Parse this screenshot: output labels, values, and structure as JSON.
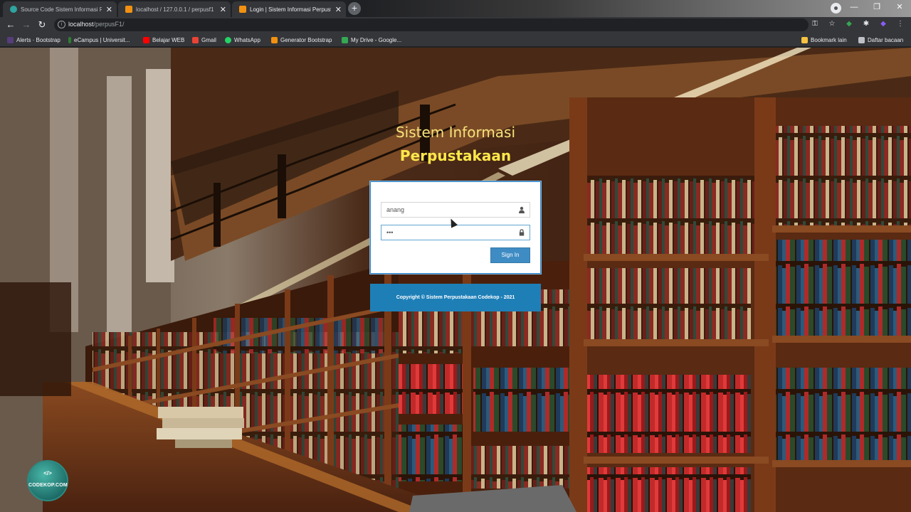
{
  "browser": {
    "tabs": [
      {
        "title": "Source Code Sistem Informasi Pe",
        "favicon_color": "#2fa4a0",
        "active": false
      },
      {
        "title": "localhost / 127.0.0.1 / perpusf1 |",
        "favicon_color": "#f29111",
        "active": false
      },
      {
        "title": "Login | Sistem Informasi Perpust",
        "favicon_color": "#f29111",
        "active": true
      }
    ],
    "new_tab": "+",
    "window_buttons": [
      "—",
      "❐",
      "✕"
    ],
    "url_host": "localhost",
    "url_path": "/perpusF1/",
    "bookmarks": [
      {
        "label": "Alerts · Bootstrap",
        "color": "#563d7c"
      },
      {
        "label": "eCampus | Universit...",
        "color": "#2e7d32"
      },
      {
        "label": "Belajar WEB",
        "color": "#ff0000"
      },
      {
        "label": "Gmail",
        "color": "#ea4335"
      },
      {
        "label": "WhatsApp",
        "color": "#25d366"
      },
      {
        "label": "Generator Bootstrap",
        "color": "#f29111"
      },
      {
        "label": "My Drive - Google...",
        "color": "#34a853"
      }
    ],
    "bookmark_other": "Bookmark lain",
    "reading_list": "Daftar bacaan"
  },
  "login": {
    "title_line1": "Sistem Informasi",
    "title_line2": "Perpustakaan",
    "username_value": "anang",
    "password_value": "•••",
    "user_icon": "user-icon",
    "lock_icon": "lock-icon",
    "sign_in_label": "Sign In",
    "footer": "Copyright © Sistem Perpustakaan Codekop - 2021"
  },
  "watermark": {
    "tag": "</>",
    "name": "CODEKOP.COM"
  },
  "colors": {
    "accent": "#3f8cc4",
    "footer": "#1e7fb7",
    "title": "#ffe84a"
  }
}
